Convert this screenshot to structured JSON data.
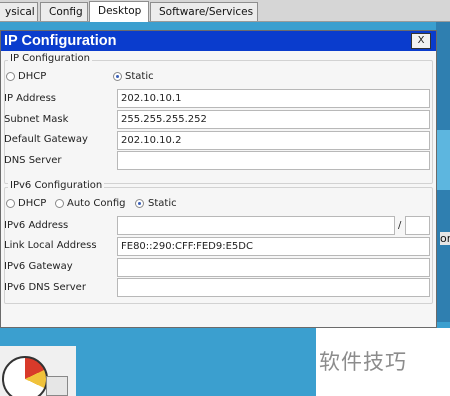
{
  "tabs": [
    {
      "label": "ysical",
      "active": false
    },
    {
      "label": "Config",
      "active": false
    },
    {
      "label": "Desktop",
      "active": true
    },
    {
      "label": "Software/Services",
      "active": false
    }
  ],
  "window": {
    "title": "IP Configuration",
    "close_label": "X"
  },
  "ipv4": {
    "group_title": "IP Configuration",
    "dhcp_label": "DHCP",
    "static_label": "Static",
    "mode": "Static",
    "ip_address": {
      "label": "IP Address",
      "value": "202.10.10.1"
    },
    "subnet_mask": {
      "label": "Subnet Mask",
      "value": "255.255.255.252"
    },
    "default_gateway": {
      "label": "Default Gateway",
      "value": "202.10.10.2"
    },
    "dns_server": {
      "label": "DNS Server",
      "value": ""
    }
  },
  "ipv6": {
    "group_title": "IPv6 Configuration",
    "dhcp_label": "DHCP",
    "auto_config_label": "Auto Config",
    "static_label": "Static",
    "mode": "Static",
    "address": {
      "label": "IPv6 Address",
      "value": "",
      "prefix_separator": "/",
      "prefix_value": ""
    },
    "link_local": {
      "label": "Link Local Address",
      "value": "FE80::290:CFF:FED9:E5DC"
    },
    "gateway": {
      "label": "IPv6 Gateway",
      "value": ""
    },
    "dns_server": {
      "label": "IPv6 DNS Server",
      "value": ""
    }
  },
  "side_fragment": "or",
  "watermark": "软件技巧",
  "colors": {
    "titlebar": "#0a3ccd",
    "desktop": "#3b9fcf"
  }
}
